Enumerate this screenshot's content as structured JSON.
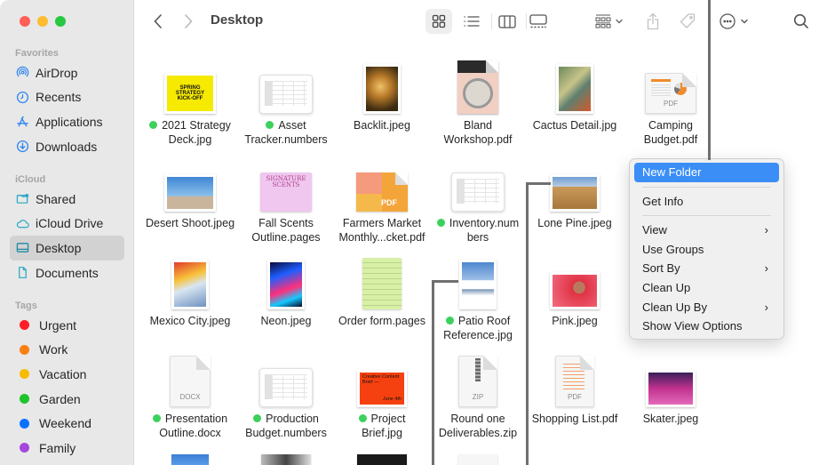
{
  "window": {
    "title": "Desktop",
    "traffic_lights": [
      "close",
      "minimize",
      "zoom"
    ]
  },
  "sidebar": {
    "sections": [
      {
        "heading": "Favorites",
        "items": [
          {
            "label": "AirDrop",
            "icon": "airdrop-icon"
          },
          {
            "label": "Recents",
            "icon": "clock-icon"
          },
          {
            "label": "Applications",
            "icon": "applications-icon"
          },
          {
            "label": "Downloads",
            "icon": "download-icon"
          }
        ]
      },
      {
        "heading": "iCloud",
        "items": [
          {
            "label": "Shared",
            "icon": "shared-folder-icon"
          },
          {
            "label": "iCloud Drive",
            "icon": "cloud-icon"
          },
          {
            "label": "Desktop",
            "icon": "desktop-icon",
            "selected": true
          },
          {
            "label": "Documents",
            "icon": "document-icon"
          }
        ]
      },
      {
        "heading": "Tags",
        "tags": [
          {
            "label": "Urgent",
            "color": "#ff1f26"
          },
          {
            "label": "Work",
            "color": "#fa7f12"
          },
          {
            "label": "Vacation",
            "color": "#f7bc00"
          },
          {
            "label": "Garden",
            "color": "#1ec42c"
          },
          {
            "label": "Weekend",
            "color": "#0a70ff"
          },
          {
            "label": "Family",
            "color": "#a546dd"
          }
        ]
      }
    ]
  },
  "toolbar": {
    "back": "back-icon",
    "forward": "forward-icon",
    "views": [
      "icon-view",
      "list-view",
      "column-view",
      "gallery-view"
    ],
    "selected_view": "icon-view",
    "group": "group-icon",
    "share": "share-icon",
    "tag": "tag-icon",
    "more": "more-icon",
    "search": "search-icon"
  },
  "files": [
    {
      "name": "2021 Strategy Deck.jpg",
      "line1": "2021 Strategy",
      "line2": "Deck.jpg",
      "tag": "#3cd15c",
      "kind": "yellow-deck"
    },
    {
      "name": "Asset Tracker.numbers",
      "line1": "Asset",
      "line2": "Tracker.numbers",
      "tag": "#3cd15c",
      "kind": "sheet"
    },
    {
      "name": "Backlit.jpeg",
      "line1": "Backlit.jpeg",
      "line2": "",
      "kind": "photo-portrait"
    },
    {
      "name": "Bland Workshop.pdf",
      "line1": "Bland",
      "line2": "Workshop.pdf",
      "kind": "pdf-cover"
    },
    {
      "name": "Cactus Detail.jpg",
      "line1": "Cactus Detail.jpg",
      "line2": "",
      "kind": "photo-cactus"
    },
    {
      "name": "Camping Budget.pdf",
      "line1": "Camping",
      "line2": "Budget.pdf",
      "kind": "pdf-chart",
      "ext": "PDF"
    },
    {
      "name": "Desert Shoot.jpeg",
      "line1": "Desert Shoot.jpeg",
      "line2": "",
      "kind": "photo-desert"
    },
    {
      "name": "Fall Scents Outline.pages",
      "line1": "Fall Scents",
      "line2": "Outline.pages",
      "kind": "pages-pink",
      "cover_text": "SIGNATURE SCENTS"
    },
    {
      "name": "Farmers Market Monthly...cket.pdf",
      "line1": "Farmers Market",
      "line2": "Monthly...cket.pdf",
      "kind": "pdf-oranges",
      "ext": "PDF"
    },
    {
      "name": "Inventory.numbers",
      "line1": "Inventory.num",
      "line2": "bers",
      "tag": "#3cd15c",
      "kind": "sheet"
    },
    {
      "name": "Lone Pine.jpeg",
      "line1": "Lone Pine.jpeg",
      "line2": "",
      "kind": "photo-rocks"
    },
    {
      "name": "Mexico City.jpeg",
      "line1": "Mexico City.jpeg",
      "line2": "",
      "kind": "photo-mexico"
    },
    {
      "name": "Neon.jpeg",
      "line1": "Neon.jpeg",
      "line2": "",
      "kind": "photo-neon"
    },
    {
      "name": "Order form.pages",
      "line1": "Order form.pages",
      "line2": "",
      "kind": "pages-green"
    },
    {
      "name": "Patio Roof Reference.jpg",
      "line1": "Patio Roof",
      "line2": "Reference.jpg",
      "tag": "#3cd15c",
      "kind": "photo-patio"
    },
    {
      "name": "Pink.jpeg",
      "line1": "Pink.jpeg",
      "line2": "",
      "kind": "photo-pink"
    },
    {
      "name": "Presentation Outline.docx",
      "line1": "Presentation",
      "line2": "Outline.docx",
      "tag": "#3cd15c",
      "kind": "doc",
      "ext": "DOCX"
    },
    {
      "name": "Production Budget.numbers",
      "line1": "Production",
      "line2": "Budget.numbers",
      "tag": "#3cd15c",
      "kind": "sheet"
    },
    {
      "name": "Project Brief.jpg",
      "line1": "Project",
      "line2": "Brief.jpg",
      "tag": "#3cd15c",
      "kind": "orange-brief",
      "cover_text": "Creative Content Brief —",
      "cover_date": "June 4th"
    },
    {
      "name": "Round one Deliverables.zip",
      "line1": "Round one",
      "line2": "Deliverables.zip",
      "kind": "zip",
      "ext": "ZIP"
    },
    {
      "name": "Shopping List.pdf",
      "line1": "Shopping List.pdf",
      "line2": "",
      "kind": "pdf-list",
      "ext": "PDF"
    },
    {
      "name": "Skater.jpeg",
      "line1": "Skater.jpeg",
      "line2": "",
      "kind": "photo-skater"
    }
  ],
  "context_menu": {
    "items": [
      {
        "label": "New Folder",
        "highlighted": true
      },
      {
        "separator": true
      },
      {
        "label": "Get Info"
      },
      {
        "separator": true
      },
      {
        "label": "View",
        "submenu": true
      },
      {
        "label": "Use Groups"
      },
      {
        "label": "Sort By",
        "submenu": true
      },
      {
        "label": "Clean Up"
      },
      {
        "label": "Clean Up By",
        "submenu": true
      },
      {
        "label": "Show View Options"
      }
    ],
    "chevron": "›"
  }
}
